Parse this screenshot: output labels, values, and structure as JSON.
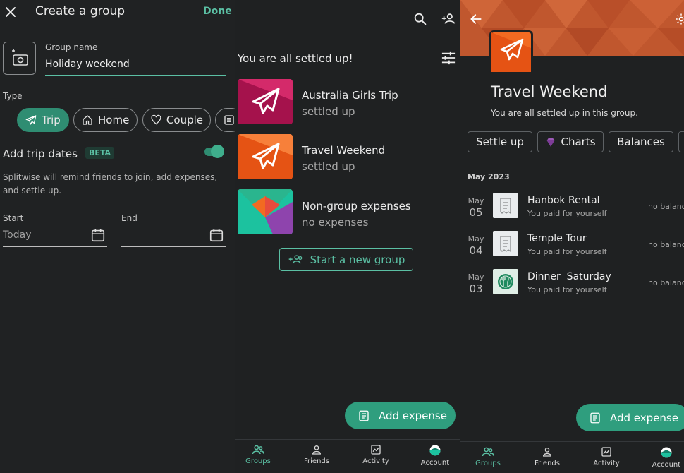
{
  "create_group": {
    "title": "Create a group",
    "done_label": "Done",
    "group_name_label": "Group name",
    "group_name_value": "Holiday weekend",
    "type_label": "Type",
    "types": [
      {
        "label": "Trip",
        "icon": "plane-icon",
        "selected": true
      },
      {
        "label": "Home",
        "icon": "home-icon",
        "selected": false
      },
      {
        "label": "Couple",
        "icon": "heart-icon",
        "selected": false
      },
      {
        "label": "",
        "icon": "list-icon",
        "selected": false
      }
    ],
    "trip_dates_label": "Add trip dates",
    "beta_badge": "BETA",
    "trip_dates_enabled": true,
    "hint": "Splitwise will remind friends to join, add expenses, and settle up.",
    "start_label": "Start",
    "start_placeholder": "Today",
    "end_label": "End",
    "end_value": ""
  },
  "groups_list": {
    "header": "You are all settled up!",
    "groups": [
      {
        "name": "Australia Girls Trip",
        "status": "settled up"
      },
      {
        "name": "Travel Weekend",
        "status": "settled up"
      },
      {
        "name": "Non-group expenses",
        "status": "no expenses"
      }
    ],
    "new_group_label": "Start a new group",
    "fab_label": "Add expense"
  },
  "group_detail": {
    "title": "Travel Weekend",
    "subtitle": "You are all settled up in this group.",
    "tabs": [
      {
        "label": "Settle up"
      },
      {
        "label": "Charts",
        "icon": "gem-icon"
      },
      {
        "label": "Balances"
      }
    ],
    "month_header": "May 2023",
    "expenses": [
      {
        "month": "May",
        "day": "05",
        "title": "Hanbok Rental",
        "sub": "You paid for yourself",
        "balance": "no balance",
        "icon": "receipt-icon"
      },
      {
        "month": "May",
        "day": "04",
        "title": "Temple Tour",
        "sub": "You paid for yourself",
        "balance": "no balance",
        "icon": "receipt-icon"
      },
      {
        "month": "May",
        "day": "03",
        "title": "Dinner  Saturday",
        "sub": "You paid for yourself",
        "balance": "no balance",
        "icon": "utensils-icon"
      }
    ],
    "fab_label": "Add expense"
  },
  "nav": {
    "items": [
      {
        "label": "Groups",
        "icon": "groups-icon",
        "active": true
      },
      {
        "label": "Friends",
        "icon": "person-icon",
        "active": false
      },
      {
        "label": "Activity",
        "icon": "activity-icon",
        "active": false
      },
      {
        "label": "Account",
        "icon": "account-icon",
        "active": false
      }
    ]
  },
  "colors": {
    "accent": "#5bc0a4",
    "accent_dark": "#2f8d72",
    "background": "#1f2122"
  }
}
